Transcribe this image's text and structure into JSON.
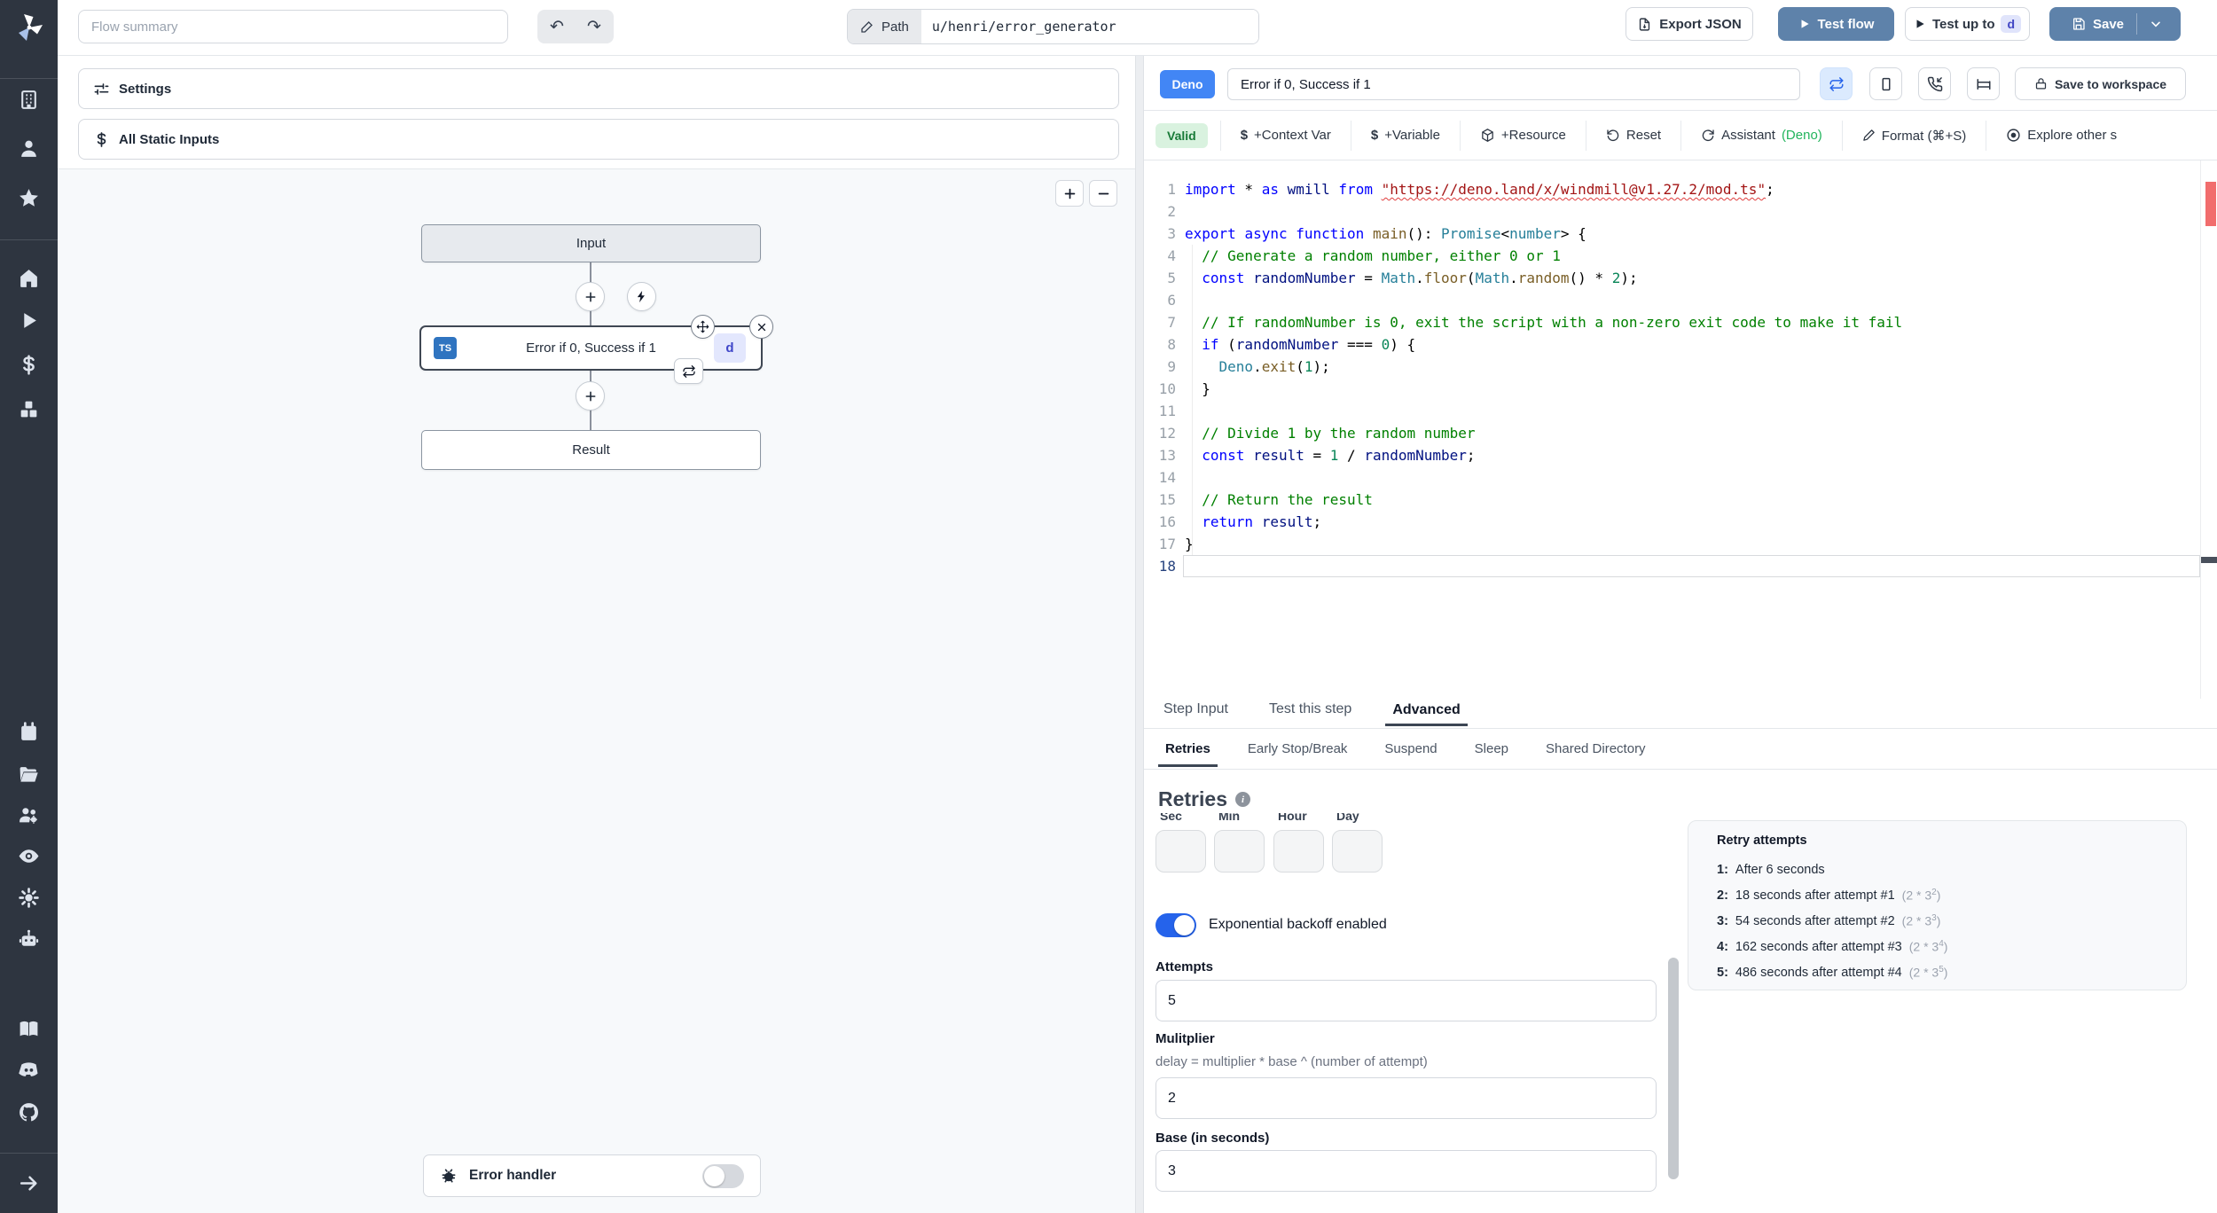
{
  "topbar": {
    "flow_summary_placeholder": "Flow summary",
    "path_label": "Path",
    "path_value": "u/henri/error_generator",
    "export_json_label": "Export JSON",
    "test_flow_label": "Test flow",
    "test_up_to_label": "Test up to",
    "test_up_to_badge": "d",
    "save_label": "Save"
  },
  "sidebar": {
    "icon_names": [
      "windmill-logo",
      "building",
      "user",
      "star",
      "home",
      "play",
      "dollar",
      "boxes",
      "calendar",
      "folder-open",
      "users",
      "eye",
      "gear",
      "robot",
      "book",
      "discord",
      "github",
      "arrow-right"
    ]
  },
  "left_panel": {
    "settings_label": "Settings",
    "all_static_inputs_label": "All Static Inputs",
    "graph": {
      "input_node_label": "Input",
      "step_node_label": "Error if 0, Success if 1",
      "step_lang_badge": "TS",
      "step_id_badge": "d",
      "result_node_label": "Result",
      "error_handler_label": "Error handler"
    }
  },
  "editor_header": {
    "lang_badge": "Deno",
    "step_name": "Error if 0, Success if 1",
    "save_to_workspace_label": "Save to workspace"
  },
  "toolbar": {
    "valid_label": "Valid",
    "context_var_label": "+Context Var",
    "variable_label": "+Variable",
    "resource_label": "+Resource",
    "reset_label": "Reset",
    "assistant_label": "Assistant",
    "assistant_suffix": "(Deno)",
    "format_label": "Format (⌘+S)",
    "explore_label": "Explore other s"
  },
  "editor": {
    "code_lines": [
      "import * as wmill from \"https://deno.land/x/windmill@v1.27.2/mod.ts\";",
      "",
      "export async function main(): Promise<number> {",
      "  // Generate a random number, either 0 or 1",
      "  const randomNumber = Math.floor(Math.random() * 2);",
      "",
      "  // If randomNumber is 0, exit the script with a non-zero exit code to make it fail",
      "  if (randomNumber === 0) {",
      "    Deno.exit(1);",
      "  }",
      "",
      "  // Divide 1 by the random number",
      "  const result = 1 / randomNumber;",
      "",
      "  // Return the result",
      "  return result;",
      "}",
      ""
    ]
  },
  "advanced": {
    "tabs": [
      {
        "label": "Step Input"
      },
      {
        "label": "Test this step"
      },
      {
        "label": "Advanced"
      }
    ],
    "subtabs": [
      {
        "label": "Retries"
      },
      {
        "label": "Early Stop/Break"
      },
      {
        "label": "Suspend"
      },
      {
        "label": "Sleep"
      },
      {
        "label": "Shared Directory"
      }
    ],
    "retries": {
      "title": "Retries",
      "time_labels": [
        "Sec",
        "Min",
        "Hour",
        "Day"
      ],
      "backoff_toggle_label": "Exponential backoff enabled",
      "attempts_label": "Attempts",
      "attempts_value": "5",
      "multiplier_label": "Mulitplier",
      "multiplier_help": "delay = multiplier * base ^ (number of attempt)",
      "multiplier_value": "2",
      "base_label": "Base (in seconds)",
      "base_value": "3"
    },
    "retry_attempts": {
      "title": "Retry attempts",
      "rows": [
        {
          "index": "1:",
          "text": "After 6 seconds",
          "formula_prefix": "",
          "formula_sup": "",
          "formula_suffix": ""
        },
        {
          "index": "2:",
          "text": "18 seconds after attempt #1",
          "formula_prefix": "(2 * 3",
          "formula_sup": "2",
          "formula_suffix": ")"
        },
        {
          "index": "3:",
          "text": "54 seconds after attempt #2",
          "formula_prefix": "(2 * 3",
          "formula_sup": "3",
          "formula_suffix": ")"
        },
        {
          "index": "4:",
          "text": "162 seconds after attempt #3",
          "formula_prefix": "(2 * 3",
          "formula_sup": "4",
          "formula_suffix": ")"
        },
        {
          "index": "5:",
          "text": "486 seconds after attempt #4",
          "formula_prefix": "(2 * 3",
          "formula_sup": "5",
          "formula_suffix": ")"
        }
      ]
    }
  },
  "colors": {
    "accent_blue_button": "#5e82aa",
    "deno_badge_blue": "#4286f5",
    "valid_green_bg": "#d9f2df",
    "valid_green_text": "#187a37",
    "sidebar_bg": "#2e3540",
    "toggle_on_blue": "#2563eb",
    "ts_badge_blue": "#2f74c0"
  }
}
